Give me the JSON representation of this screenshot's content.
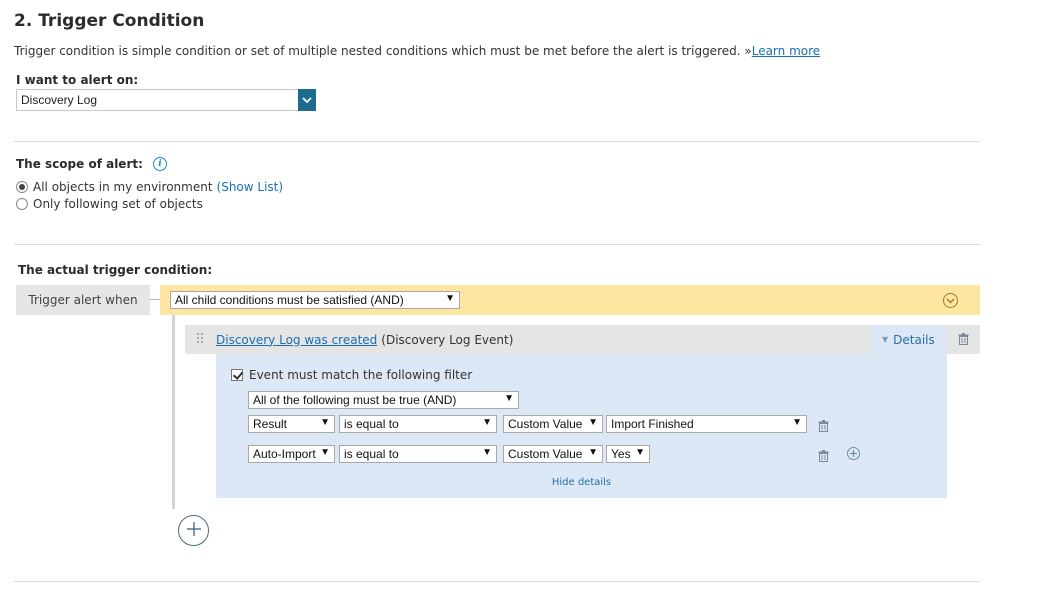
{
  "section": {
    "title": "2. Trigger Condition",
    "description": "Trigger condition is simple condition or set of multiple nested conditions which must be met before the alert is triggered. »",
    "learn_more": "Learn more"
  },
  "alert_on": {
    "label": "I want to alert on:",
    "value": "Discovery Log"
  },
  "scope": {
    "label": "The scope of alert:",
    "option_all": "All objects in my environment",
    "show_list": "(Show List)",
    "option_following": "Only following set of objects",
    "selected": "All objects in my environment"
  },
  "trigger": {
    "heading": "The actual trigger condition:",
    "label": "Trigger alert when",
    "condition": "All child conditions must be satisfied (AND)",
    "event_link": "Discovery Log was created",
    "event_type": "(Discovery Log Event)",
    "details": "Details",
    "filter_checkbox_label": "Event must match the following filter",
    "filter_mode": "All of the following must be true (AND)",
    "rows": [
      {
        "field": "Result",
        "operator": "is equal to",
        "value_type": "Custom Value",
        "value": "Import Finished"
      },
      {
        "field": "Auto-Import",
        "operator": "is equal to",
        "value_type": "Custom Value",
        "value": "Yes"
      }
    ],
    "hide_details": "Hide details"
  },
  "colors": {
    "accent": "#1d6a8f",
    "link": "#1a6fb3",
    "condition_bar": "#fde7a0",
    "filter_bg": "#dde8f6"
  },
  "icons": [
    "chevron-down-icon",
    "info-icon",
    "collapse-icon",
    "drag-handle-icon",
    "trash-icon",
    "add-icon"
  ]
}
